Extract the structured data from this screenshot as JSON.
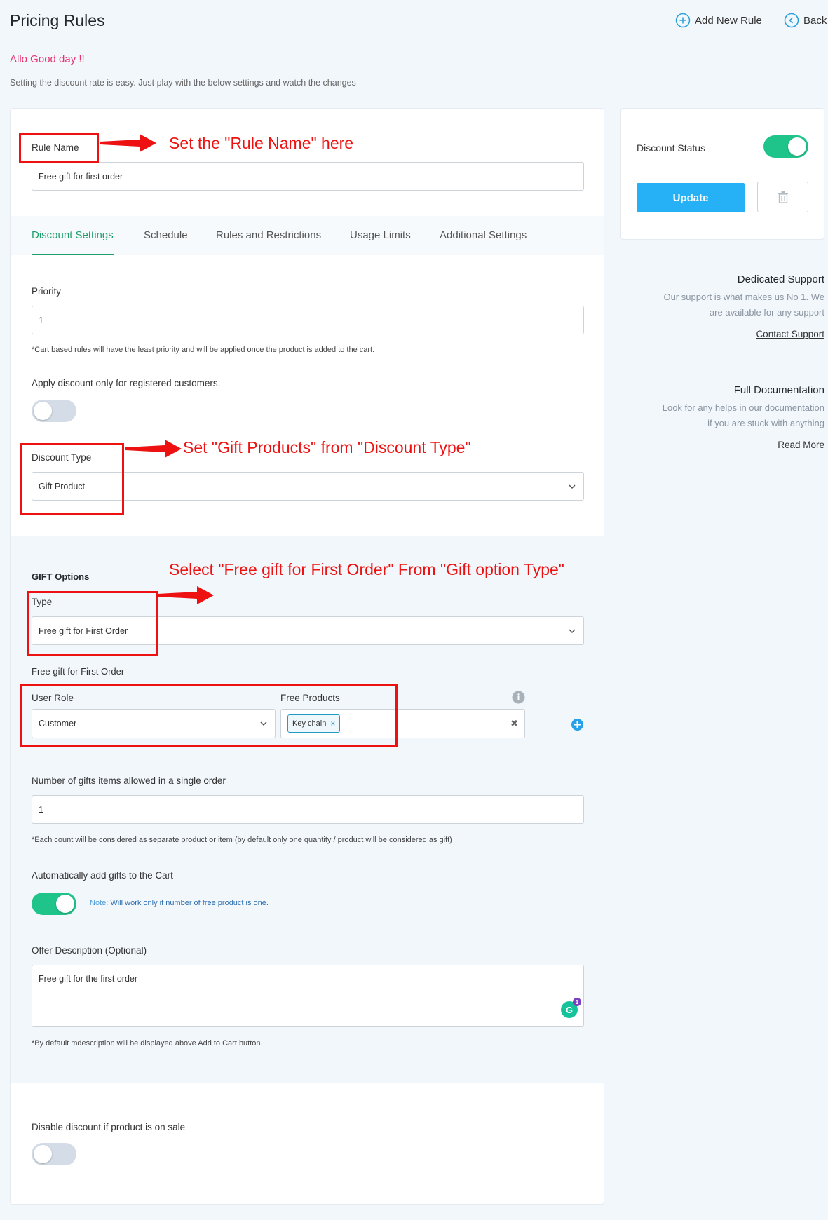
{
  "header": {
    "title": "Pricing Rules",
    "add_rule_label": "Add New Rule",
    "back_label": "Back",
    "greeting": "Allo Good day !!",
    "intro": "Setting the discount rate is easy. Just play with the below settings and watch the changes"
  },
  "rule_name": {
    "label": "Rule Name",
    "value": "Free gift for first order"
  },
  "tabs": [
    {
      "label": "Discount Settings",
      "active": true
    },
    {
      "label": "Schedule",
      "active": false
    },
    {
      "label": "Rules and Restrictions",
      "active": false
    },
    {
      "label": "Usage Limits",
      "active": false
    },
    {
      "label": "Additional Settings",
      "active": false
    }
  ],
  "priority": {
    "label": "Priority",
    "value": "1",
    "hint": "*Cart based rules will have the least priority and will be applied once the product is added to the cart."
  },
  "registered_only": {
    "label": "Apply discount only for registered customers.",
    "enabled": false
  },
  "discount_type": {
    "label": "Discount Type",
    "value": "Gift Product"
  },
  "gift_options": {
    "heading": "GIFT Options",
    "type_label": "Type",
    "type_value": "Free gift for First Order",
    "subheading": "Free gift for First Order",
    "user_role_label": "User Role",
    "user_role_value": "Customer",
    "free_products_label": "Free Products",
    "free_products": [
      "Key chain"
    ],
    "gifts_count_label": "Number of gifts items allowed in a single order",
    "gifts_count_value": "1",
    "gifts_count_hint": "*Each count will be considered as separate product or item (by default only one quantity / product will be considered as gift)",
    "auto_add_label": "Automatically add gifts to the Cart",
    "auto_add_enabled": true,
    "auto_add_note_prefix": "Note:",
    "auto_add_note": "Will work only if number of free product is one.",
    "offer_desc_label": "Offer Description (Optional)",
    "offer_desc_value": "Free gift for the first order",
    "offer_desc_hint": "*By default mdescription will be displayed above Add to Cart button.",
    "grammarly_count": "1"
  },
  "disable_on_sale": {
    "label": "Disable discount if product is on sale",
    "enabled": false
  },
  "sidebar": {
    "status_label": "Discount Status",
    "status_enabled": true,
    "update_label": "Update",
    "support_title": "Dedicated Support",
    "support_text_1": "Our support is what makes us No 1. We",
    "support_text_2": "are available for any support",
    "support_link": "Contact Support",
    "docs_title": "Full Documentation",
    "docs_text_1": "Look for any helps in our documentation",
    "docs_text_2": "if you are stuck with anything",
    "docs_link": "Read More"
  },
  "annotations": {
    "rule_name": "Set the \"Rule Name\" here",
    "discount_type": "Set \"Gift Products\" from \"Discount Type\"",
    "gift_type": "Select \"Free gift for First Order\" From \"Gift option Type\""
  },
  "colors": {
    "accent_green": "#1fc48a",
    "tab_active": "#1f9e6b",
    "update_blue": "#26b0f5",
    "greeting_pink": "#e8336d",
    "annotation_red": "#ee1111"
  }
}
